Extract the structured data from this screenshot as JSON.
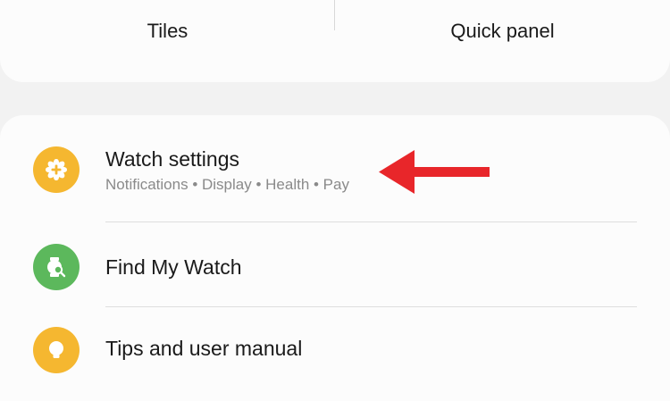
{
  "top_tabs": [
    {
      "label": "Tiles"
    },
    {
      "label": "Quick panel"
    }
  ],
  "menu": {
    "items": [
      {
        "title": "Watch settings",
        "subtitle": "Notifications • Display • Health • Pay",
        "icon": "gear-icon",
        "icon_color": "#f5b730"
      },
      {
        "title": "Find My Watch",
        "icon": "find-watch-icon",
        "icon_color": "#5cb85c"
      },
      {
        "title": "Tips and user manual",
        "icon": "lightbulb-icon",
        "icon_color": "#f5b730"
      }
    ]
  },
  "annotation": {
    "arrow_color": "#e8262a",
    "arrow_icon": "arrow-left-icon"
  }
}
